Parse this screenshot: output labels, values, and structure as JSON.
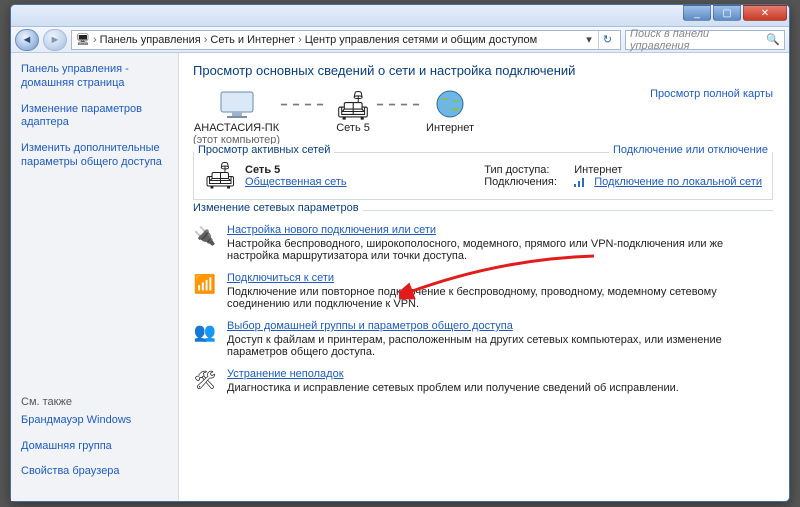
{
  "titlebar": {
    "min": "_",
    "max": "▢",
    "close": "✕"
  },
  "nav": {
    "back": "◄",
    "fwd": "►",
    "crumb_home_icon": "🖥",
    "crumbs": [
      "Панель управления",
      "Сеть и Интернет",
      "Центр управления сетями и общим доступом"
    ],
    "dropdown": "▾",
    "refresh": "↻"
  },
  "search": {
    "placeholder": "Поиск в панели управления",
    "icon": "🔍"
  },
  "sidebar": {
    "items": [
      "Панель управления - домашняя страница",
      "Изменение параметров адаптера",
      "Изменить дополнительные параметры общего доступа"
    ],
    "seealso_hdr": "См. также",
    "seealso": [
      "Брандмауэр Windows",
      "Домашняя группа",
      "Свойства браузера"
    ]
  },
  "main": {
    "title": "Просмотр основных сведений о сети и настройка подключений",
    "map_full": "Просмотр полной карты",
    "nodes": {
      "pc_name": "АНАСТАСИЯ-ПК",
      "pc_sub": "(этот компьютер)",
      "net_name": "Сеть 5",
      "internet": "Интернет"
    },
    "active_legend": "Просмотр активных сетей",
    "active_rlink": "Подключение или отключение",
    "active": {
      "name": "Сеть 5",
      "type": "Общественная сеть",
      "access_lbl": "Тип доступа:",
      "access_val": "Интернет",
      "conn_lbl": "Подключения:",
      "conn_val": "Подключение по локальной сети"
    },
    "change_legend": "Изменение сетевых параметров",
    "tasks": [
      {
        "icon": "🔌",
        "title": "Настройка нового подключения или сети",
        "desc": "Настройка беспроводного, широкополосного, модемного, прямого или VPN-подключения или же настройка маршрутизатора или точки доступа."
      },
      {
        "icon": "📶",
        "title": "Подключиться к сети",
        "desc": "Подключение или повторное подключение к беспроводному, проводному, модемному сетевому соединению или подключение к VPN."
      },
      {
        "icon": "👥",
        "title": "Выбор домашней группы и параметров общего доступа",
        "desc": "Доступ к файлам и принтерам, расположенным на других сетевых компьютерах, или изменение параметров общего доступа."
      },
      {
        "icon": "🛠",
        "title": "Устранение неполадок",
        "desc": "Диагностика и исправление сетевых проблем или получение сведений об исправлении."
      }
    ]
  }
}
